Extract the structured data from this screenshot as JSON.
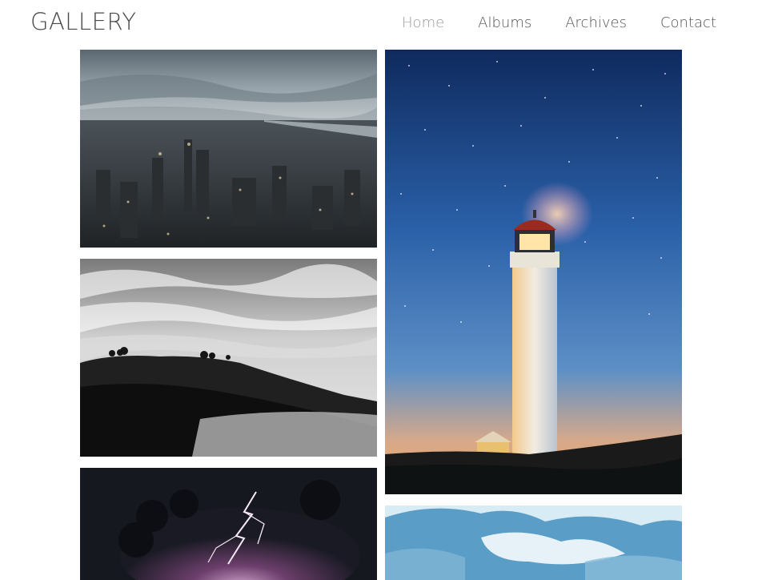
{
  "header": {
    "logo": "GALLERY",
    "nav": [
      {
        "label": "Home",
        "active": true
      },
      {
        "label": "Albums",
        "active": false
      },
      {
        "label": "Archives",
        "active": false
      },
      {
        "label": "Contact",
        "active": false
      }
    ]
  },
  "photos": [
    {
      "subject": "aerial city skyline at dusk"
    },
    {
      "subject": "black and white sea of clouds over hills"
    },
    {
      "subject": "purple lightning storm at night"
    },
    {
      "subject": "lighthouse under starry twilight sky"
    },
    {
      "subject": "blue sky with clouds"
    }
  ],
  "colors": {
    "logo": "#4a4a4a",
    "nav_text": "#555555",
    "nav_active": "#9a9a9a",
    "background": "#ffffff"
  }
}
